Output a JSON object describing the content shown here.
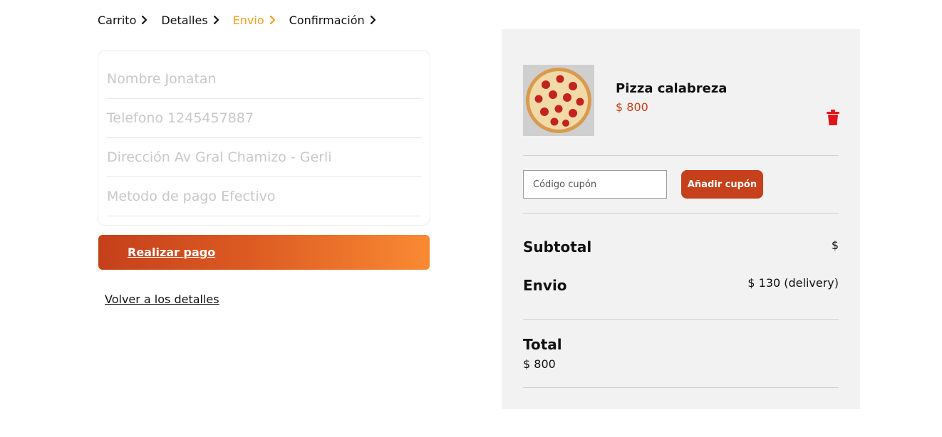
{
  "breadcrumb": [
    {
      "label": "Carrito"
    },
    {
      "label": "Detalles"
    },
    {
      "label": "Envio"
    },
    {
      "label": "Confirmación"
    }
  ],
  "breadcrumb_active_color": "#f0a020",
  "form": {
    "nombre": "Nombre Jonatan",
    "telefono": "Telefono 1245457887",
    "direccion": "Dirección Av Gral Chamizo - Gerli",
    "metodo_pago": "Metodo de pago Efectivo"
  },
  "pay_button_label": "Realizar pago",
  "back_link_label": "Volver a los detalles",
  "cart": {
    "item_name": "Pizza calabreza",
    "item_price": "$ 800",
    "item_image_icon": "pizza-image",
    "delete_icon": "trash-icon",
    "coupon_placeholder": "Código cupón",
    "coupon_button_label": "Añadir cupón",
    "subtotal_label": "Subtotal",
    "subtotal_value": "$",
    "envio_label": "Envio",
    "envio_value": "$ 130 (delivery)",
    "total_label": "Total",
    "total_value": "$ 800"
  },
  "colors": {
    "accent": "#c5401b",
    "gradient_end": "#f98a33",
    "trash": "#e0141a",
    "panel_bg": "#f2f2f2"
  }
}
